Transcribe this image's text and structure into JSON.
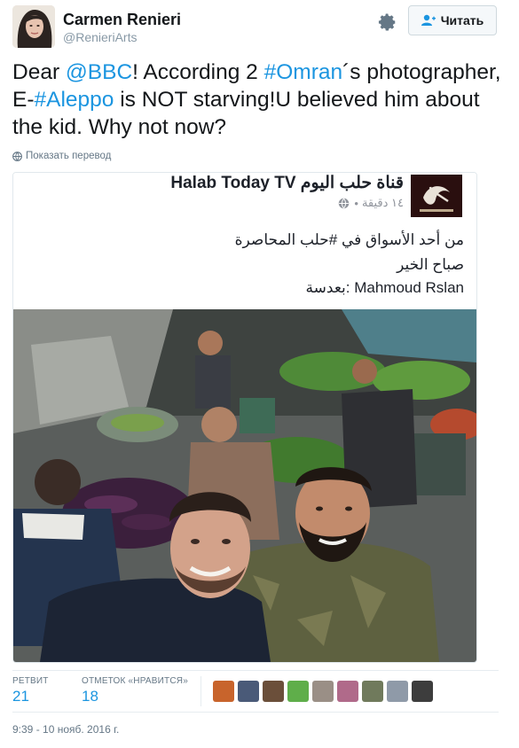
{
  "user": {
    "name": "Carmen Renieri",
    "handle": "@RenieriArts",
    "follow_label": "Читать"
  },
  "tweet": {
    "part1": "Dear ",
    "mention": "@BBC",
    "part2": "! According 2 ",
    "hashtag1": "#Omran",
    "part3": "´s photographer, E-",
    "hashtag2": "#Aleppo",
    "part4": " is NOT starving!U believed him about the kid. Why not now?",
    "translate_label": "Показать перевод"
  },
  "embedded_post": {
    "page_name": "Halab Today TV قناة حلب اليوم",
    "meta_time": "١٤ دقيقة",
    "line1": "من أحد الأسواق في #حلب المحاصرة",
    "line2": "صباح الخير",
    "line3": "بعدسة: Mahmoud Rslan"
  },
  "stats": {
    "retweets_label": "РЕТВИТ",
    "retweets_value": "21",
    "likes_label": "ОТМЕТОК «НРАВИТСЯ»",
    "likes_value": "18"
  },
  "liker_avatar_colors": [
    "#c8642c",
    "#4a5a78",
    "#6b4f3a",
    "#5fae4a",
    "#9a8f86",
    "#b06a8a",
    "#707a5c",
    "#8f9aa8",
    "#3d3d3d"
  ],
  "timestamp": "9:39 - 10 нояб. 2016 г."
}
